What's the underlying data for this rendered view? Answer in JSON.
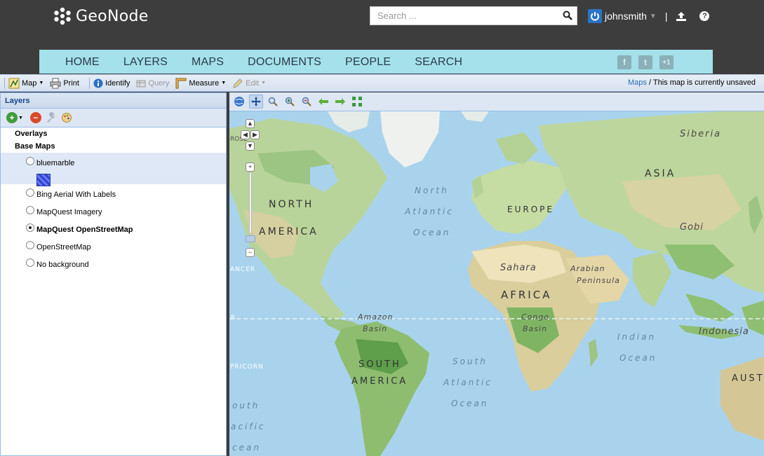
{
  "app": {
    "logo_text": "GeoNode"
  },
  "header": {
    "search_placeholder": "Search ...",
    "username": "johnsmith",
    "separator": "|",
    "help_label": "?"
  },
  "nav": {
    "items": [
      "HOME",
      "LAYERS",
      "MAPS",
      "DOCUMENTS",
      "PEOPLE",
      "SEARCH"
    ],
    "social": [
      "f",
      "t",
      "+1"
    ]
  },
  "toolbar": {
    "map": "Map",
    "print": "Print",
    "identify": "Identify",
    "query": "Query",
    "measure": "Measure",
    "edit": "Edit",
    "status_link": "Maps",
    "status_text": " / This map is currently unsaved"
  },
  "layers_panel": {
    "title": "Layers",
    "folders": {
      "overlays": "Overlays",
      "base_maps": "Base Maps"
    },
    "base_maps": [
      {
        "label": "bluemarble",
        "selected_row": true,
        "checked": false
      },
      {
        "label": "Bing Aerial With Labels",
        "checked": false
      },
      {
        "label": "MapQuest Imagery",
        "checked": false
      },
      {
        "label": "MapQuest OpenStreetMap",
        "checked": true
      },
      {
        "label": "OpenStreetMap",
        "checked": false
      },
      {
        "label": "No background",
        "checked": false
      }
    ]
  },
  "map": {
    "labels": {
      "siberia": "Siberia",
      "asia": "ASIA",
      "north": "NORTH",
      "america": "AMERICA",
      "north2": "North",
      "atlantic": "Atlantic",
      "ocean": "Ocean",
      "europe": "EUROPE",
      "gobi": "Gobi",
      "sahara": "Sahara",
      "arabian": "Arabian",
      "peninsula": "Peninsula",
      "africa": "AFRICA",
      "amazon": "Amazon",
      "basin": "Basin",
      "congo": "Congo",
      "basin2": "Basin",
      "indian": "Indian",
      "ocean2": "Ocean",
      "indonesia": "Indonesia",
      "south": "SOUTH",
      "america2": "AMERICA",
      "south2": "South",
      "atlantic2": "Atlantic",
      "ocean3": "Ocean",
      "aust": "AUST",
      "cancer": "ANCER",
      "eq": "R",
      "capricorn": "PRICORN",
      "outh": "outh",
      "acific": "acific",
      "cean": "cean",
      "rose": "ROSE"
    }
  }
}
